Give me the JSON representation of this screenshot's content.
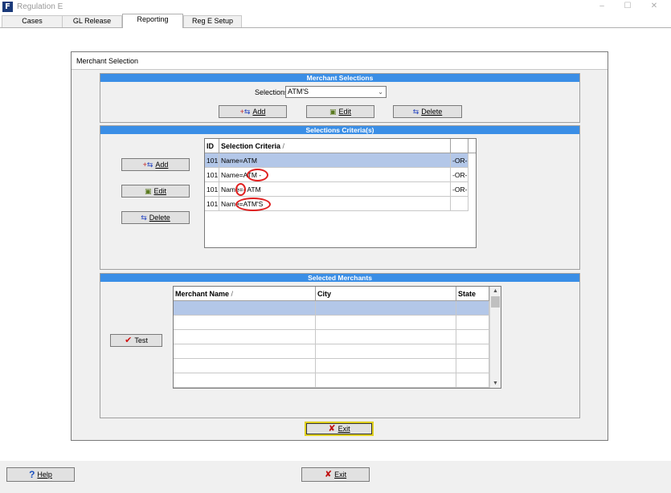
{
  "window": {
    "title": "Regulation E",
    "app_icon": "F",
    "minimize": "–",
    "maximize": "☐",
    "close": "✕"
  },
  "tabs": [
    {
      "label": "Cases"
    },
    {
      "label": "GL Release"
    },
    {
      "label": "Reporting"
    },
    {
      "label": "Reg E Setup"
    }
  ],
  "dialog": {
    "title": "Merchant Selection",
    "merchant_selections": {
      "header": "Merchant Selections",
      "selections_label": "Selections",
      "selections_value": "ATM'S",
      "add_label": "Add",
      "edit_label": "Edit",
      "delete_label": "Delete"
    },
    "criteria": {
      "header": "Selections Criteria(s)",
      "add_label": "Add",
      "edit_label": "Edit",
      "delete_label": "Delete",
      "columns": {
        "id": "ID",
        "criteria": "Selection Criteria",
        "sort": "/"
      },
      "rows": [
        {
          "id": "101",
          "criteria": "Name=ATM",
          "op": "-OR-"
        },
        {
          "id": "101",
          "criteria": "Name=ATM -",
          "op": "-OR-"
        },
        {
          "id": "101",
          "criteria": "Name=- ATM",
          "op": "-OR-"
        },
        {
          "id": "101",
          "criteria": "Name=ATM'S",
          "op": ""
        }
      ]
    },
    "merchants": {
      "header": "Selected Merchants",
      "test_label": "Test",
      "columns": {
        "name": "Merchant Name",
        "sort": "/",
        "city": "City",
        "state": "State"
      }
    },
    "exit_label": "Exit"
  },
  "footer": {
    "help_label": "Help",
    "exit_label": "Exit"
  }
}
